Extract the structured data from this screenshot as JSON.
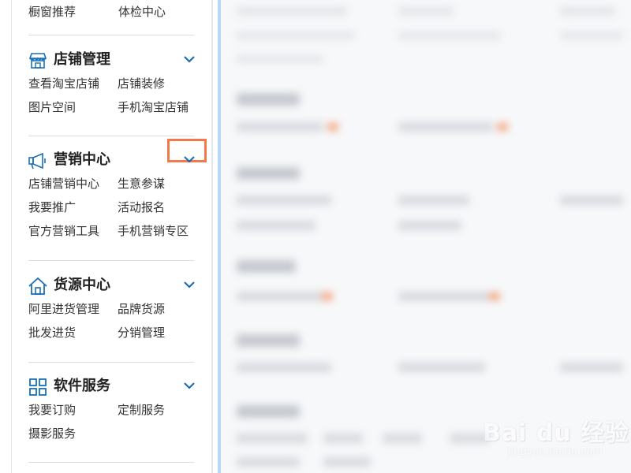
{
  "sidebar": {
    "top_links": [
      "橱窗推荐",
      "体检中心"
    ],
    "sections": [
      {
        "title": "店铺管理",
        "icon": "store-icon",
        "links": [
          "查看淘宝店铺",
          "店铺装修",
          "图片空间",
          "手机淘宝店铺"
        ]
      },
      {
        "title": "营销中心",
        "icon": "megaphone-icon",
        "links": [
          "店铺营销中心",
          "生意参谋",
          "我要推广",
          "活动报名",
          "官方营销工具",
          "手机营销专区"
        ]
      },
      {
        "title": "货源中心",
        "icon": "house-icon",
        "links": [
          "阿里进货管理",
          "品牌货源",
          "批发进货",
          "分销管理"
        ]
      },
      {
        "title": "软件服务",
        "icon": "grid-icon",
        "links": [
          "我要订购",
          "定制服务",
          "摄影服务"
        ]
      }
    ]
  },
  "highlight": {
    "color": "#f07a4b"
  },
  "watermark": {
    "main": "Bai du 经验",
    "sub": "jingyan.baidu.com"
  },
  "colors": {
    "accent": "#1a6fb5",
    "sidebar_edge": "#b9d7f2"
  }
}
